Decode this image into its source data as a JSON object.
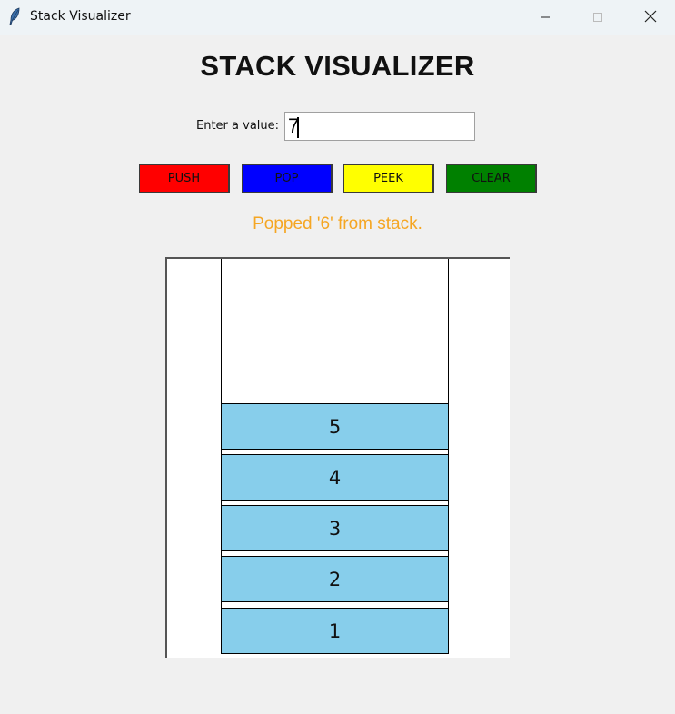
{
  "window": {
    "title": "Stack Visualizer",
    "controls": {
      "minimize_icon": "minimize-icon",
      "maximize_icon": "maximize-icon",
      "close_icon": "close-icon"
    }
  },
  "app": {
    "heading": "STACK VISUALIZER",
    "input": {
      "label": "Enter a value:",
      "value": "7"
    },
    "buttons": {
      "push": "PUSH",
      "pop": "POP",
      "peek": "PEEK",
      "clear": "CLEAR"
    },
    "button_colors": {
      "push": "#ff0000",
      "pop": "#0000ff",
      "peek": "#ffff00",
      "clear": "#008000"
    },
    "status": "Popped '6' from stack.",
    "status_color": "#f5a623",
    "stack": {
      "item_color": "#87ceeb",
      "items_top_to_bottom": [
        "5",
        "4",
        "3",
        "2",
        "1"
      ]
    }
  }
}
